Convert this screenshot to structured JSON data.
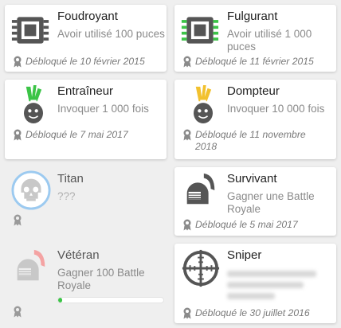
{
  "achievements": [
    {
      "title": "Foudroyant",
      "desc": "Avoir utilisé 100 puces",
      "unlocked": "Débloqué le 10 février 2015",
      "icon": "chip-icon",
      "icon_color": "#555555"
    },
    {
      "title": "Fulgurant",
      "desc": "Avoir utilisé 1 000 puces",
      "unlocked": "Débloqué le 11 février 2015",
      "icon": "chip-icon",
      "icon_color": "#3cc447"
    },
    {
      "title": "Entraîneur",
      "desc": "Invoquer 1 000 fois",
      "unlocked": "Débloqué le 7 mai 2017",
      "icon": "leek-icon",
      "icon_color": "#3cc447"
    },
    {
      "title": "Dompteur",
      "desc": "Invoquer 10 000 fois",
      "unlocked": "Débloqué le 11 novembre 2018",
      "icon": "leek-icon",
      "icon_color": "#f2c12e"
    },
    {
      "title": "Titan",
      "desc": "???",
      "icon": "skull-icon",
      "icon_color": "#9ccaf0"
    },
    {
      "title": "Survivant",
      "desc": "Gagner une Battle Royale",
      "unlocked": "Débloqué le 5 mai 2017",
      "icon": "knight-helmet-icon",
      "icon_color": "#555555"
    },
    {
      "title": "Vétéran",
      "desc": "Gagner 100 Battle Royale",
      "progress": 0.04,
      "icon": "knight-helmet-icon",
      "icon_color": "#f4a3a3"
    },
    {
      "title": "Sniper",
      "unlocked": "Débloqué le 30 juillet 2016",
      "icon": "crosshair-icon",
      "icon_color": "#555555"
    }
  ]
}
